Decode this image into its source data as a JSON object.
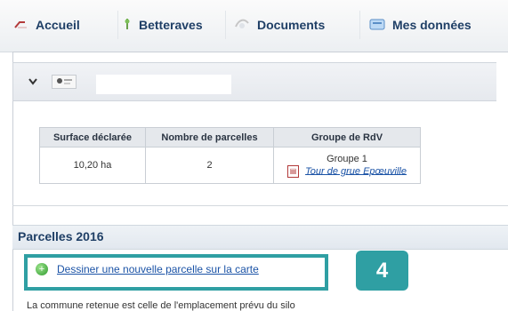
{
  "nav": {
    "items": [
      {
        "label": "Accueil",
        "icon": "home-icon"
      },
      {
        "label": "Betteraves",
        "icon": "beet-icon"
      },
      {
        "label": "Documents",
        "icon": "documents-icon"
      },
      {
        "label": "Mes données",
        "icon": "data-icon"
      }
    ]
  },
  "summary": {
    "headers": [
      "Surface déclarée",
      "Nombre de parcelles",
      "Groupe de RdV"
    ],
    "surface": "10,20 ha",
    "parcel_count": "2",
    "group_label": "Groupe 1",
    "group_link": "Tour de grue Epœuville"
  },
  "section": {
    "title": "Parcelles 2016",
    "draw_link": "Dessiner une nouvelle parcelle sur la carte",
    "badge": "4",
    "note": "La commune retenue est celle de l'emplacement prévu du silo"
  },
  "colors": {
    "nav_text": "#1f3f66",
    "link": "#1b53a6",
    "teal_highlight": "#2f9fa3"
  }
}
